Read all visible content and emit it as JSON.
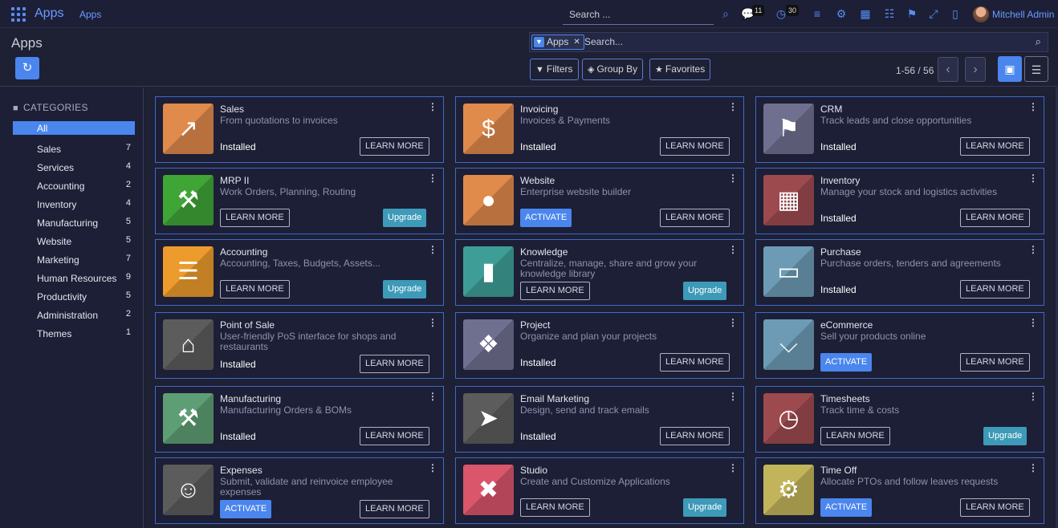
{
  "navbar": {
    "brand": "Apps",
    "menu_apps": "Apps",
    "search_placeholder": "Search ...",
    "messages_count": "11",
    "activities_count": "30",
    "user_name": "Mitchell Admin"
  },
  "control": {
    "title": "Apps",
    "facet_label": "Apps",
    "search_placeholder": "Search...",
    "filters": "Filters",
    "group_by": "Group By",
    "favorites": "Favorites",
    "pager": "1-56 / 56"
  },
  "sidebar": {
    "heading": "CATEGORIES",
    "items": [
      {
        "label": "All",
        "count": ""
      },
      {
        "label": "Sales",
        "count": "7"
      },
      {
        "label": "Services",
        "count": "4"
      },
      {
        "label": "Accounting",
        "count": "2"
      },
      {
        "label": "Inventory",
        "count": "4"
      },
      {
        "label": "Manufacturing",
        "count": "5"
      },
      {
        "label": "Website",
        "count": "5"
      },
      {
        "label": "Marketing",
        "count": "7"
      },
      {
        "label": "Human Resources",
        "count": "9"
      },
      {
        "label": "Productivity",
        "count": "5"
      },
      {
        "label": "Administration",
        "count": "2"
      },
      {
        "label": "Themes",
        "count": "1"
      }
    ]
  },
  "apps": [
    {
      "name": "Sales",
      "summary": "From quotations to invoices",
      "status": "Installed",
      "learn": "LEARN MORE",
      "action": "",
      "icon": "trend-up-icon",
      "color": "#e08a4c"
    },
    {
      "name": "Invoicing",
      "summary": "Invoices & Payments",
      "status": "Installed",
      "learn": "LEARN MORE",
      "action": "",
      "icon": "invoice-dollar-icon",
      "color": "#e08a4c"
    },
    {
      "name": "CRM",
      "summary": "Track leads and close opportunities",
      "status": "Installed",
      "learn": "LEARN MORE",
      "action": "",
      "icon": "handshake-icon",
      "color": "#6f6f8f"
    },
    {
      "name": "MRP II",
      "summary": "Work Orders, Planning, Routing",
      "status": "",
      "learn": "LEARN MORE",
      "action": "Upgrade",
      "icon": "wrench-icon",
      "color": "#3fa535"
    },
    {
      "name": "Website",
      "summary": "Enterprise website builder",
      "status": "",
      "learn": "LEARN MORE",
      "action": "ACTIVATE",
      "icon": "globe-icon",
      "color": "#e08a4c"
    },
    {
      "name": "Inventory",
      "summary": "Manage your stock and logistics activities",
      "status": "Installed",
      "learn": "LEARN MORE",
      "action": "",
      "icon": "box-icon",
      "color": "#9d4a4f"
    },
    {
      "name": "Accounting",
      "summary": "Accounting, Taxes, Budgets, Assets...",
      "status": "",
      "learn": "LEARN MORE",
      "action": "Upgrade",
      "icon": "document-icon",
      "color": "#ec9b2c"
    },
    {
      "name": "Knowledge",
      "summary": "Centralize, manage, share and grow your knowledge library",
      "status": "",
      "learn": "LEARN MORE",
      "action": "Upgrade",
      "icon": "book-icon",
      "color": "#3e9e97"
    },
    {
      "name": "Purchase",
      "summary": "Purchase orders, tenders and agreements",
      "status": "Installed",
      "learn": "LEARN MORE",
      "action": "",
      "icon": "credit-card-icon",
      "color": "#6d9bb5"
    },
    {
      "name": "Point of Sale",
      "summary": "User-friendly PoS interface for shops and restaurants",
      "status": "Installed",
      "learn": "LEARN MORE",
      "action": "",
      "icon": "shop-icon",
      "color": "#5c5c5c"
    },
    {
      "name": "Project",
      "summary": "Organize and plan your projects",
      "status": "Installed",
      "learn": "LEARN MORE",
      "action": "",
      "icon": "puzzle-icon",
      "color": "#6f6f8f"
    },
    {
      "name": "eCommerce",
      "summary": "Sell your products online",
      "status": "",
      "learn": "LEARN MORE",
      "action": "ACTIVATE",
      "icon": "cart-icon",
      "color": "#6d9bb5"
    },
    {
      "name": "Manufacturing",
      "summary": "Manufacturing Orders & BOMs",
      "status": "Installed",
      "learn": "LEARN MORE",
      "action": "",
      "icon": "wrench-icon",
      "color": "#5e9e74"
    },
    {
      "name": "Email Marketing",
      "summary": "Design, send and track emails",
      "status": "Installed",
      "learn": "LEARN MORE",
      "action": "",
      "icon": "paper-plane-icon",
      "color": "#5c5c5c"
    },
    {
      "name": "Timesheets",
      "summary": "Track time & costs",
      "status": "",
      "learn": "LEARN MORE",
      "action": "Upgrade",
      "icon": "stopwatch-icon",
      "color": "#9d4a4f"
    },
    {
      "name": "Expenses",
      "summary": "Submit, validate and reinvoice employee expenses",
      "status": "",
      "learn": "LEARN MORE",
      "action": "ACTIVATE",
      "icon": "user-dollar-icon",
      "color": "#5c5c5c"
    },
    {
      "name": "Studio",
      "summary": "Create and Customize Applications",
      "status": "",
      "learn": "LEARN MORE",
      "action": "Upgrade",
      "icon": "tools-icon",
      "color": "#d9566b"
    },
    {
      "name": "Time Off",
      "summary": "Allocate PTOs and follow leaves requests",
      "status": "",
      "learn": "LEARN MORE",
      "action": "ACTIVATE",
      "icon": "user-gear-icon",
      "color": "#c2b45a"
    }
  ]
}
